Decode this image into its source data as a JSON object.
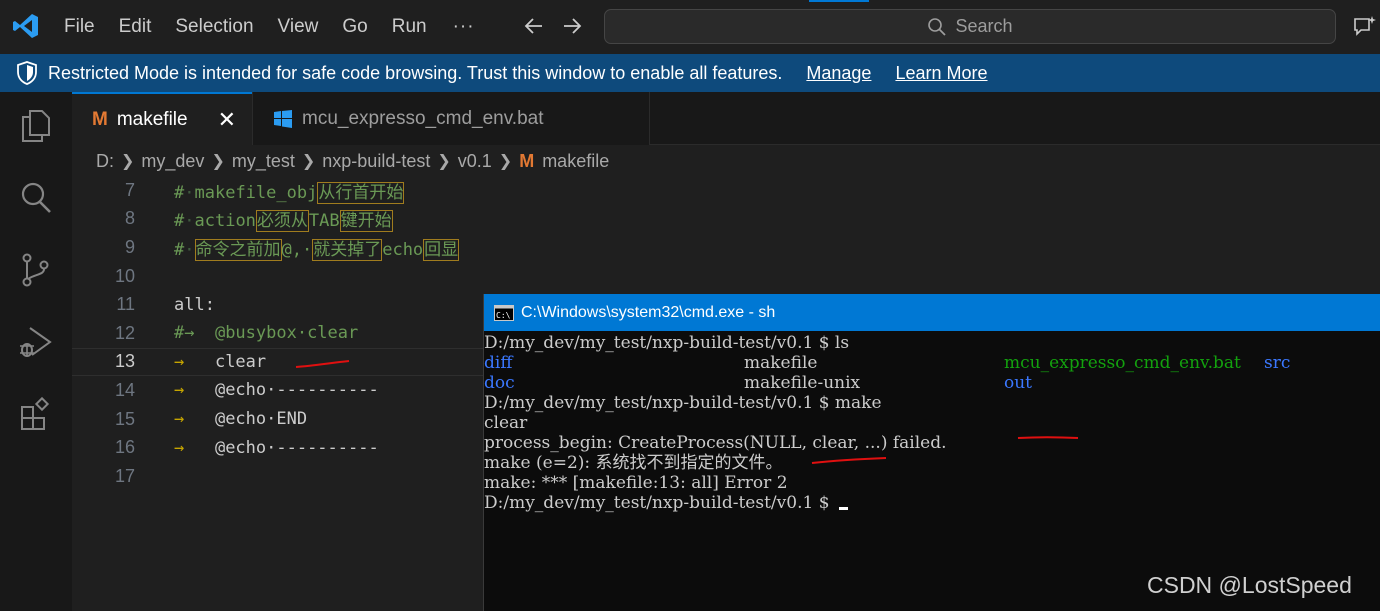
{
  "menu": [
    "File",
    "Edit",
    "Selection",
    "View",
    "Go",
    "Run"
  ],
  "menu_more": "···",
  "search": {
    "label": "Search"
  },
  "banner": {
    "text": "Restricted Mode is intended for safe code browsing. Trust this window to enable all features.",
    "manage": "Manage",
    "learn_more": "Learn More"
  },
  "tabs": {
    "active": {
      "icon_letter": "M",
      "label": "makefile",
      "close": "✕"
    },
    "inactive": {
      "label": "mcu_expresso_cmd_env.bat"
    }
  },
  "breadcrumb": [
    "D:",
    "my_dev",
    "my_test",
    "nxp-build-test",
    "v0.1",
    "makefile"
  ],
  "breadcrumb_icon": "M",
  "code": {
    "numbers": [
      "7",
      "8",
      "9",
      "10",
      "11",
      "12",
      "13",
      "14",
      "15",
      "16",
      "17"
    ],
    "l7": {
      "hash": "#",
      "dot": "·",
      "a": "makefile_obj",
      "b": "从行首开始"
    },
    "l8": {
      "hash": "#",
      "dot": "·",
      "a": "action",
      "b": "必须从",
      "c": "TAB",
      "d": "键开始"
    },
    "l9": {
      "hash": "#",
      "dot": "·",
      "a": "命令之前加",
      "b": "@,·",
      "c": "就关掉了",
      "d": "echo",
      "e": "回显"
    },
    "l11": "all:",
    "l12": {
      "hash": "#→",
      "text": "  @busybox·clear"
    },
    "l13": {
      "arrow": "→",
      "text": "   clear"
    },
    "l14": {
      "arrow": "→",
      "text": "   @echo·----------"
    },
    "l15": {
      "arrow": "→",
      "text": "   @echo·END"
    },
    "l16": {
      "arrow": "→",
      "text": "   @echo·----------"
    }
  },
  "cmd": {
    "title": "C:\\Windows\\system32\\cmd.exe - sh",
    "l1": "D:/my_dev/my_test/nxp-build-test/v0.1 $ ls",
    "ls_row1": [
      "diff",
      "makefile",
      "mcu_expresso_cmd_env.bat",
      "src"
    ],
    "ls_row2": [
      "doc",
      "makefile-unix",
      "out"
    ],
    "l4": "D:/my_dev/my_test/nxp-build-test/v0.1 $ make",
    "l5": "clear",
    "l6": "process_begin: CreateProcess(NULL, clear, ...) failed.",
    "l7": "make (e=2): 系统找不到指定的文件。",
    "l8": "make: *** [makefile:13: all] Error 2",
    "l9": "D:/my_dev/my_test/nxp-build-test/v0.1 $ "
  },
  "watermark": "CSDN @LostSpeed",
  "colors": {
    "accent": "#0078d4",
    "banner": "#0e4a7c",
    "makefile_icon": "#e37933",
    "comment": "#6a9955",
    "ls_dir": "#3b78ff",
    "ls_exec": "#13a10e",
    "annotation": "#e01010"
  }
}
